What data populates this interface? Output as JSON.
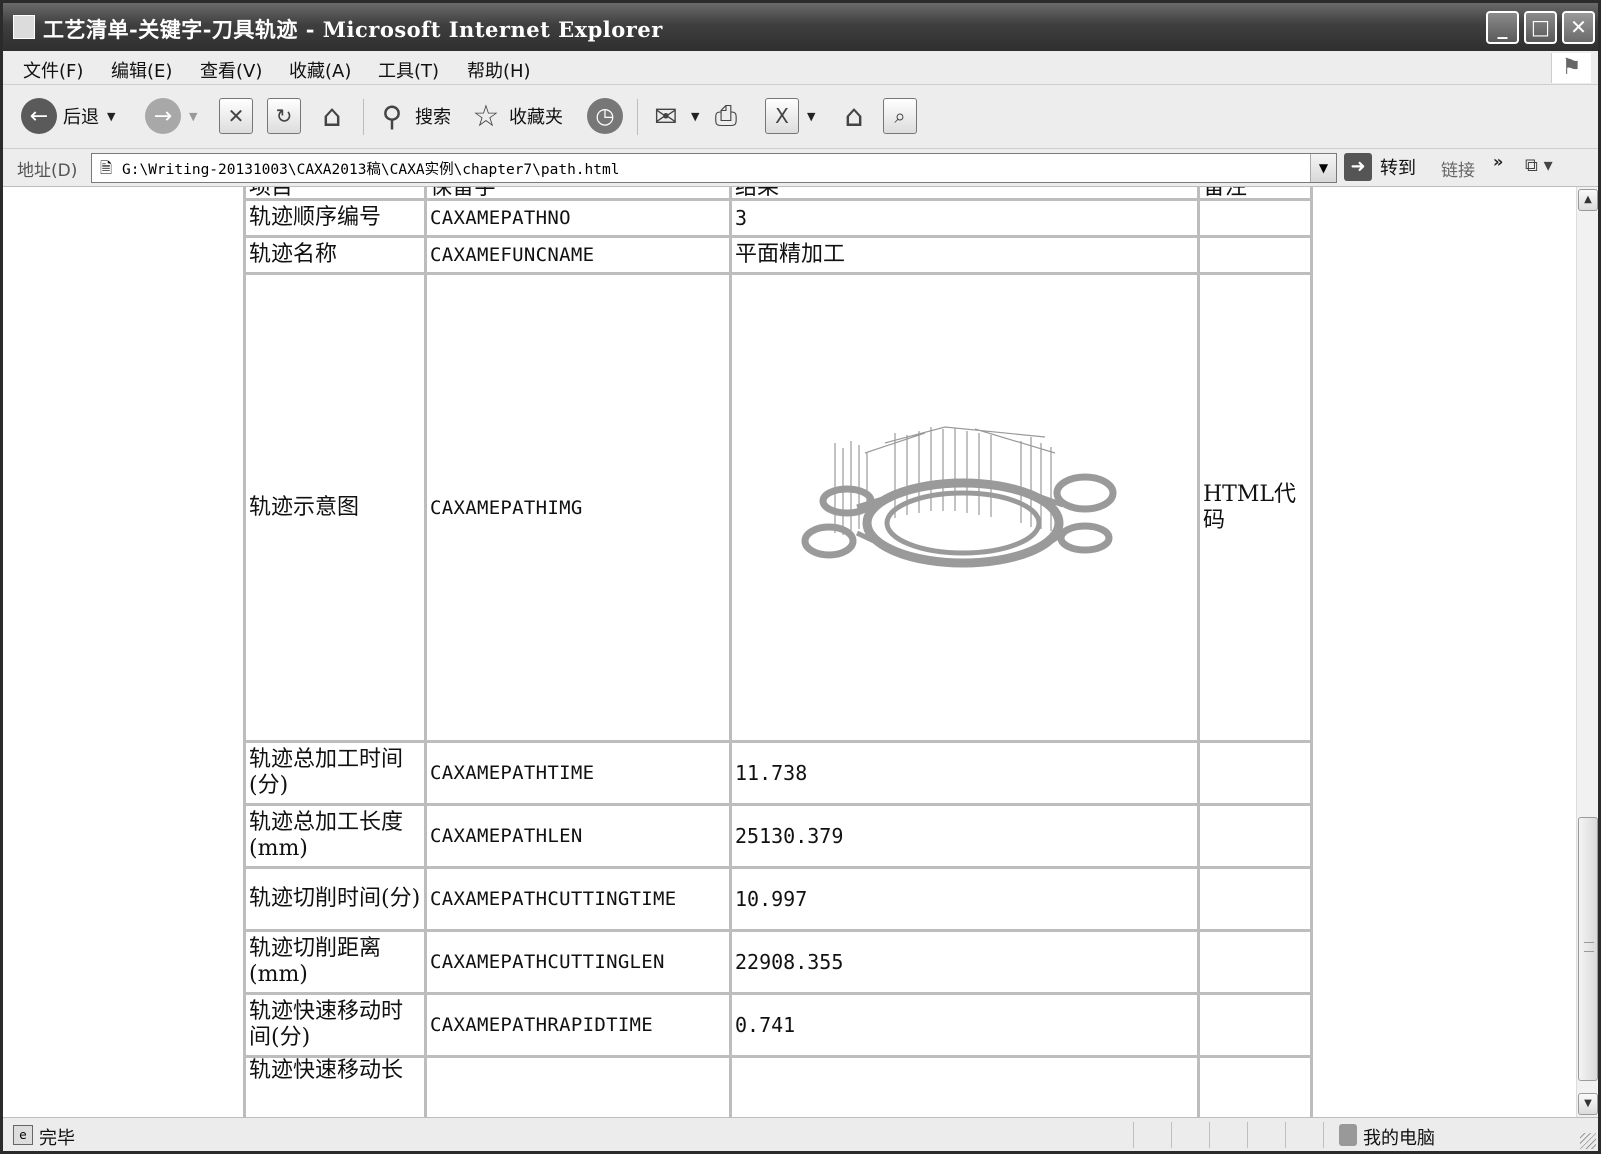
{
  "window": {
    "title": "工艺清单-关键字-刀具轨迹 - Microsoft Internet Explorer",
    "min_glyph": "_",
    "max_glyph": "□",
    "close_glyph": "✕"
  },
  "menu": {
    "items": [
      "文件(F)",
      "编辑(E)",
      "查看(V)",
      "收藏(A)",
      "工具(T)",
      "帮助(H)"
    ]
  },
  "toolbar": {
    "back_label": "后退",
    "search_label": "搜索",
    "favorites_label": "收藏夹"
  },
  "address": {
    "label": "地址(D)",
    "url": "G:\\Writing-20131003\\CAXA2013稿\\CAXA实例\\chapter7\\path.html",
    "go_label": "转到",
    "links_label": "链接"
  },
  "table": {
    "header": [
      "项目",
      "保留字",
      "结果",
      "备注"
    ],
    "rows": [
      {
        "item": "轨迹顺序编号",
        "keyword": "CAXAMEPATHNO",
        "result": "3",
        "note": ""
      },
      {
        "item": "轨迹名称",
        "keyword": "CAXAMEFUNCNAME",
        "result": "平面精加工",
        "note": ""
      },
      {
        "item": "轨迹示意图",
        "keyword": "CAXAMEPATHIMG",
        "result": "",
        "note": "HTML代码"
      },
      {
        "item": "轨迹总加工时间(分)",
        "keyword": "CAXAMEPATHTIME",
        "result": "11.738",
        "note": ""
      },
      {
        "item": "轨迹总加工长度(mm)",
        "keyword": "CAXAMEPATHLEN",
        "result": "25130.379",
        "note": ""
      },
      {
        "item": "轨迹切削时间(分)",
        "keyword": "CAXAMEPATHCUTTINGTIME",
        "result": "10.997",
        "note": ""
      },
      {
        "item": "轨迹切削距离(mm)",
        "keyword": "CAXAMEPATHCUTTINGLEN",
        "result": "22908.355",
        "note": ""
      },
      {
        "item": "轨迹快速移动时间(分)",
        "keyword": "CAXAMEPATHRAPIDTIME",
        "result": "0.741",
        "note": ""
      },
      {
        "item": "轨迹快速移动长",
        "keyword": "",
        "result": "",
        "note": ""
      }
    ]
  },
  "status": {
    "text": "完毕",
    "zone": "我的电脑"
  },
  "colors": {
    "titlebar": "#3f3f3f",
    "table_border": "#bdbdbd",
    "toolpath": "#9a9a9a"
  }
}
